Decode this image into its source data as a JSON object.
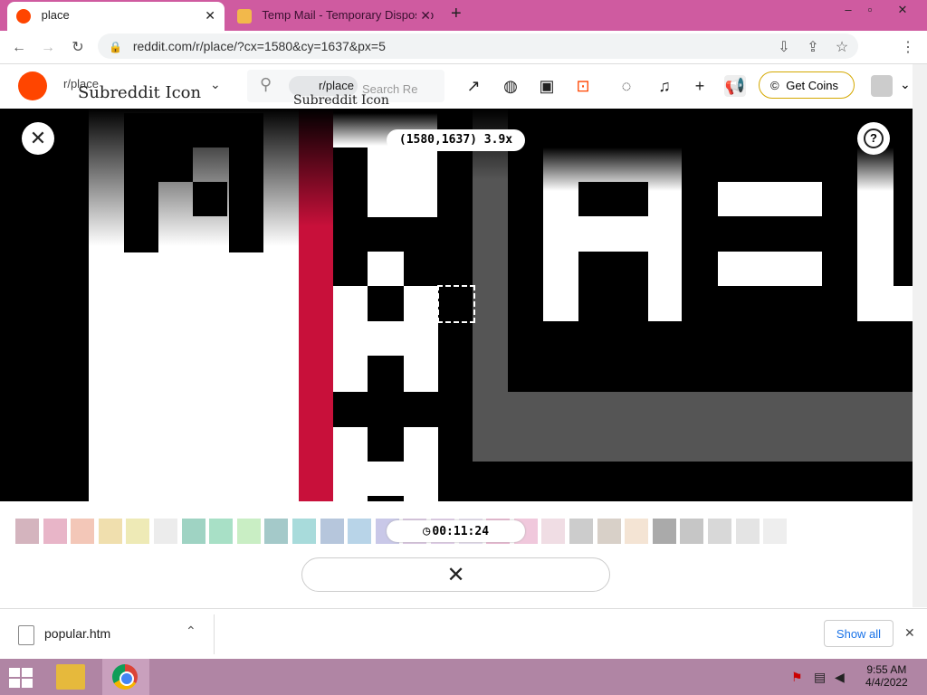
{
  "browser": {
    "tabs": [
      {
        "title": "place",
        "active": true
      },
      {
        "title": "Temp Mail - Temporary Disposab",
        "active": false
      }
    ],
    "new_tab": "+",
    "window_controls": [
      "–",
      "▫",
      "✕"
    ],
    "url": "reddit.com/r/place/?cx=1580&cy=1637&px=5"
  },
  "reddit": {
    "subreddit_icon_alt": "Subreddit Icon",
    "subreddit_name": "r/place",
    "search_chip": "r/place",
    "search_chip_alt": "Subreddit Icon",
    "search_placeholder": "Search Re",
    "get_coins": "Get Coins"
  },
  "place": {
    "coordinates": "(1580,1637) 3.9x",
    "timer": "00:11:24",
    "help": "?"
  },
  "palette": {
    "colors": [
      "#d4b4be",
      "#e8b5c8",
      "#f3c7b8",
      "#f0dfae",
      "#eeeab6",
      "#ececec",
      "#9fd3c3",
      "#a8e0c6",
      "#c9eec4",
      "#a4c9c9",
      "#a8dbdb",
      "#b6c6dc",
      "#b8d4e8",
      "#c9c8e8",
      "#ddc8e4",
      "#e4d0ec",
      "#e8e0f0",
      "#ecbad4",
      "#f0c8dc",
      "#f0dde4",
      "#cccccc",
      "#d8d0c8",
      "#f4e4d4",
      "#aaaaaa",
      "#c6c6c6",
      "#d8d8d8",
      "#e4e4e4",
      "#eeeeee"
    ]
  },
  "downloads": {
    "file": "popular.htm",
    "show_all": "Show all"
  },
  "taskbar": {
    "time": "9:55 AM",
    "date": "4/4/2022"
  }
}
